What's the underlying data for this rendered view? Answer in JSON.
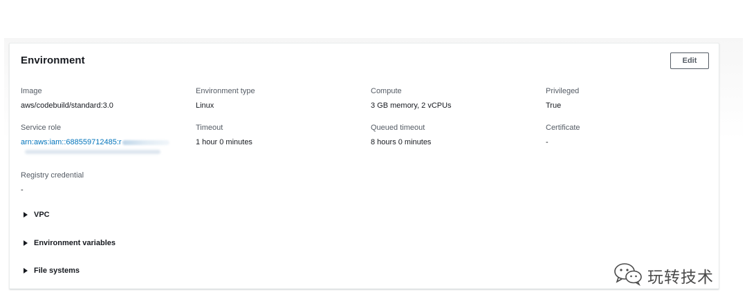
{
  "panel": {
    "title": "Environment",
    "edit_label": "Edit"
  },
  "fields": {
    "image": {
      "label": "Image",
      "value": "aws/codebuild/standard:3.0"
    },
    "environment_type": {
      "label": "Environment type",
      "value": "Linux"
    },
    "compute": {
      "label": "Compute",
      "value": "3 GB memory, 2 vCPUs"
    },
    "privileged": {
      "label": "Privileged",
      "value": "True"
    },
    "service_role": {
      "label": "Service role",
      "value": "arn:aws:iam::688559712485:r"
    },
    "timeout": {
      "label": "Timeout",
      "value": "1 hour 0 minutes"
    },
    "queued_timeout": {
      "label": "Queued timeout",
      "value": "8 hours 0 minutes"
    },
    "certificate": {
      "label": "Certificate",
      "value": "-"
    },
    "registry_credential": {
      "label": "Registry credential",
      "value": "-"
    }
  },
  "expanders": {
    "vpc": "VPC",
    "environment_variables": "Environment variables",
    "file_systems": "File systems"
  },
  "watermark": {
    "text": "玩转技术",
    "icon": "wechat-icon"
  },
  "colors": {
    "link": "#0073bb",
    "text": "#16191f",
    "label": "#545b64",
    "border": "#eaeded"
  }
}
